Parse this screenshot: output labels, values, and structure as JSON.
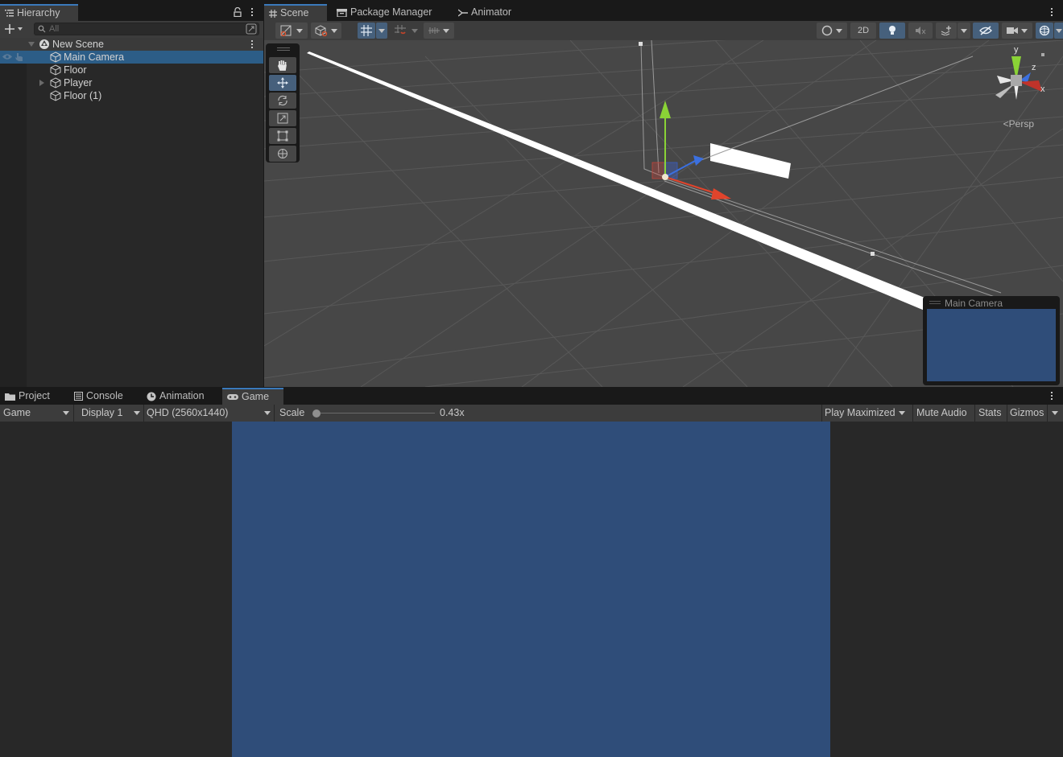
{
  "hierarchy": {
    "tab_label": "Hierarchy",
    "search_placeholder": "All",
    "scene_name": "New Scene",
    "items": [
      {
        "label": "Main Camera",
        "selected": true,
        "expandable": false
      },
      {
        "label": "Floor",
        "selected": false,
        "expandable": false
      },
      {
        "label": "Player",
        "selected": false,
        "expandable": true
      },
      {
        "label": "Floor (1)",
        "selected": false,
        "expandable": false
      }
    ]
  },
  "scene": {
    "tabs": [
      {
        "label": "Scene",
        "icon": "grid-icon",
        "active": true
      },
      {
        "label": "Package Manager",
        "icon": "package-icon",
        "active": false
      },
      {
        "label": "Animator",
        "icon": "animator-icon",
        "active": false
      }
    ],
    "toolbar": {
      "toggle_2d_label": "2D"
    },
    "tools": [
      "hand-tool",
      "move-tool",
      "rotate-tool",
      "scale-tool",
      "rect-tool",
      "transform-tool"
    ],
    "active_tool": "move-tool",
    "gizmo": {
      "x_label": "x",
      "y_label": "y",
      "z_label": "z",
      "projection_label": "Persp"
    },
    "camera_preview_title": "Main Camera"
  },
  "game": {
    "tabs": [
      {
        "label": "Project",
        "icon": "folder-icon",
        "active": false
      },
      {
        "label": "Console",
        "icon": "console-icon",
        "active": false
      },
      {
        "label": "Animation",
        "icon": "clock-icon",
        "active": false
      },
      {
        "label": "Game",
        "icon": "gamepad-icon",
        "active": true
      }
    ],
    "toolbar": {
      "view_select": "Game",
      "display_select": "Display 1",
      "resolution_select": "QHD (2560x1440)",
      "scale_label": "Scale",
      "scale_value": "0.43x",
      "scale_fraction": 0.0,
      "play_maximized_label": "Play Maximized",
      "mute_audio_label": "Mute Audio",
      "stats_label": "Stats",
      "gizmos_label": "Gizmos"
    }
  },
  "colors": {
    "selection": "#2c5d87",
    "active_toggle": "#46607c",
    "camera_background": "#2f4d79",
    "panel_bg": "#282828",
    "toolbar_bg": "#3c3c3c",
    "viewport_bg": "#474747"
  }
}
